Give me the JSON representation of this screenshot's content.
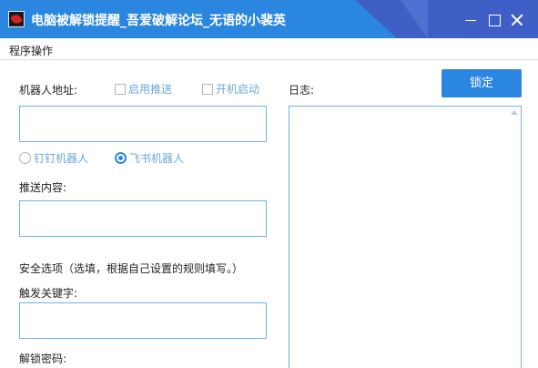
{
  "window": {
    "title": "电脑被解锁提醒_吾爱破解论坛_无语的小裴英"
  },
  "menu": {
    "items": [
      "程序操作"
    ]
  },
  "form": {
    "robot_address_label": "机器人地址:",
    "enable_push_label": "启用推送",
    "autostart_label": "开机启动",
    "robot_address_value": "",
    "robot_type_options": [
      "钉钉机器人",
      "飞书机器人"
    ],
    "robot_type_selected": "飞书机器人",
    "push_content_label": "推送内容:",
    "push_content_value": "",
    "security_options_label": "安全选项（选填，根据自己设置的规则填写。）",
    "trigger_keyword_label": "触发关键字:",
    "trigger_keyword_value": "",
    "unlock_password_label": "解锁密码:"
  },
  "log": {
    "label": "日志:",
    "content": ""
  },
  "actions": {
    "lock_label": "锁定"
  },
  "colors": {
    "titlebar": "#2b86df",
    "accent": "#2b86df",
    "field_border": "#6fb1e4",
    "checkbox_text": "#6aa8d8"
  }
}
